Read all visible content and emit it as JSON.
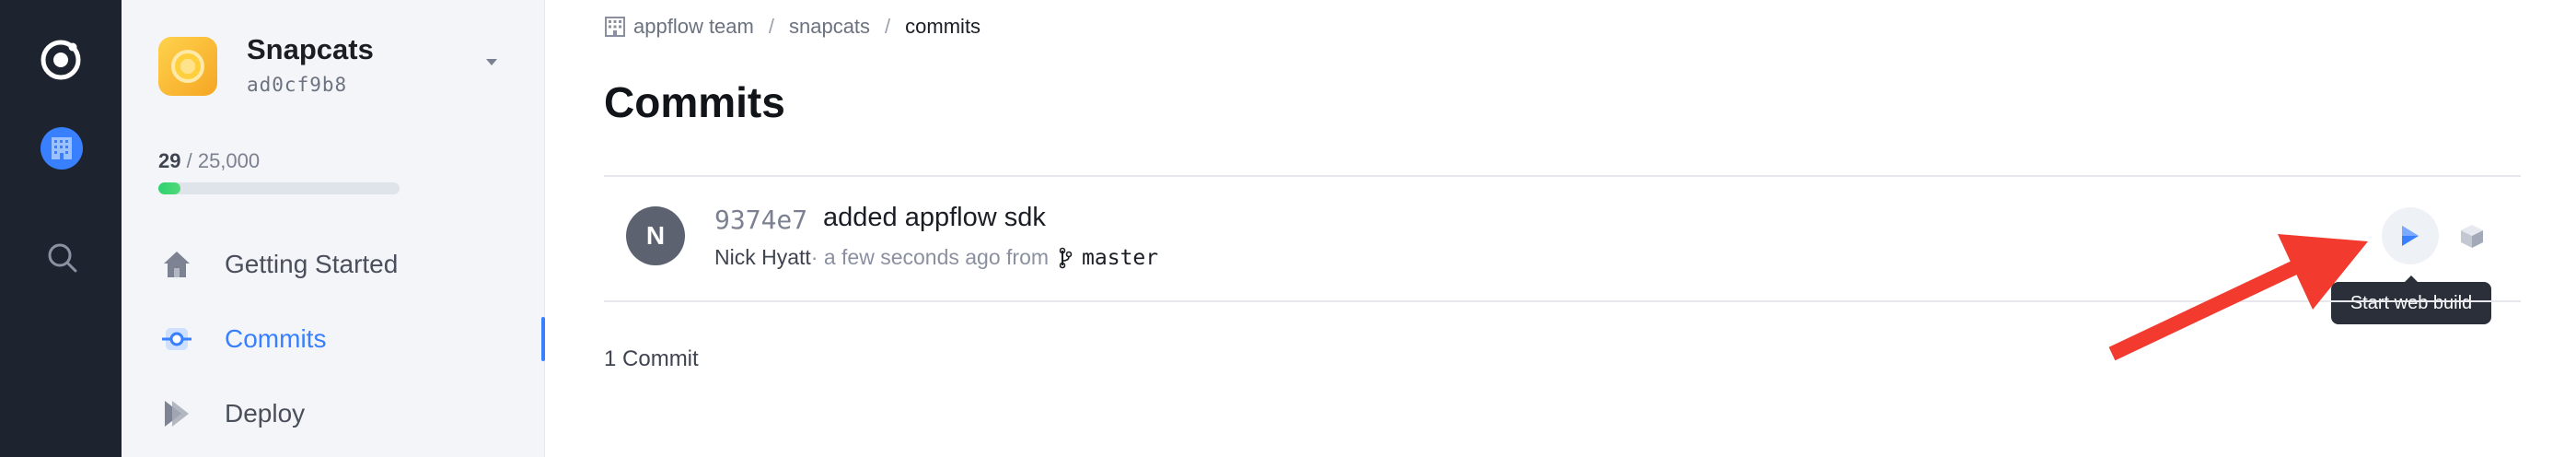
{
  "app": {
    "name": "Snapcats",
    "hash": "ad0cf9b8"
  },
  "usage": {
    "used": "29",
    "separator": " / ",
    "limit": "25,000",
    "fraction": 0.00116
  },
  "nav": {
    "items": [
      {
        "label": "Getting Started",
        "icon": "home-icon",
        "active": false
      },
      {
        "label": "Commits",
        "icon": "commit-icon",
        "active": true
      },
      {
        "label": "Deploy",
        "icon": "deploy-icon",
        "active": false
      }
    ]
  },
  "breadcrumb": {
    "team": "appflow team",
    "app": "snapcats",
    "current": "commits",
    "separator": "/"
  },
  "page": {
    "title": "Commits"
  },
  "commit": {
    "avatar_initial": "N",
    "sha": "9374e7",
    "message": "added appflow sdk",
    "author": "Nick Hyatt",
    "time_text": " · a few seconds ago from",
    "branch": "master"
  },
  "actions": {
    "web_build_icon": "play-icon",
    "native_build_icon": "cube-icon",
    "tooltip": "Start web build"
  },
  "footer": {
    "count_text": "1 Commit"
  },
  "colors": {
    "accent": "#3880ff",
    "rail": "#1e2330",
    "sidebar": "#f4f5f8",
    "annotation": "#f23a2f"
  }
}
